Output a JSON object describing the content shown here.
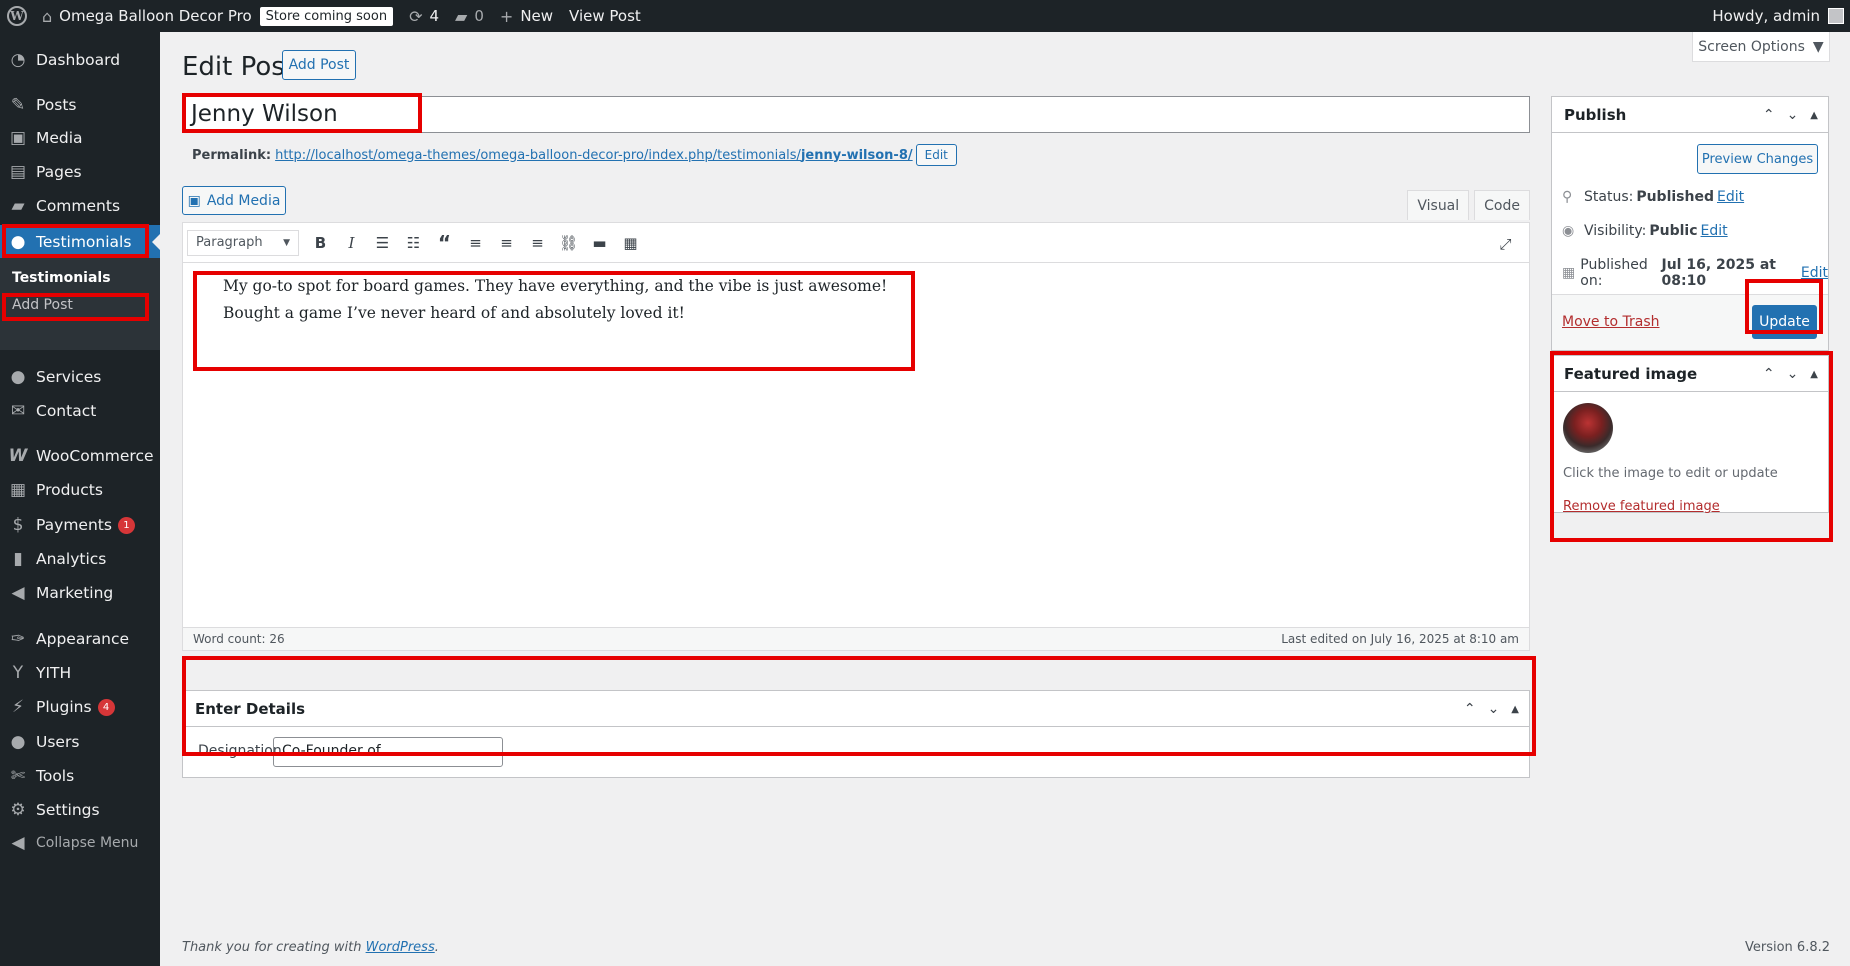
{
  "adminbar": {
    "site_name": "Omega Balloon Decor Pro",
    "store_badge": "Store coming soon",
    "updates_count": "4",
    "comments_count": "0",
    "new_label": "New",
    "view_post_label": "View Post",
    "howdy": "Howdy, admin"
  },
  "sidebar": {
    "items": [
      {
        "label": "Dashboard",
        "icon": "dashboard-icon"
      },
      {
        "label": "Posts",
        "icon": "pin-icon"
      },
      {
        "label": "Media",
        "icon": "media-icon"
      },
      {
        "label": "Pages",
        "icon": "pages-icon"
      },
      {
        "label": "Comments",
        "icon": "comments-icon"
      },
      {
        "label": "Testimonials",
        "icon": "user-icon"
      },
      {
        "label": "Services",
        "icon": "user-icon"
      },
      {
        "label": "Contact",
        "icon": "envelope-icon"
      },
      {
        "label": "WooCommerce",
        "icon": "woo-icon"
      },
      {
        "label": "Products",
        "icon": "archive-icon"
      },
      {
        "label": "Payments",
        "icon": "payments-icon",
        "badge": "1"
      },
      {
        "label": "Analytics",
        "icon": "chart-icon"
      },
      {
        "label": "Marketing",
        "icon": "megaphone-icon"
      },
      {
        "label": "Appearance",
        "icon": "brush-icon"
      },
      {
        "label": "YITH",
        "icon": "yith-icon"
      },
      {
        "label": "Plugins",
        "icon": "plugin-icon",
        "badge": "4"
      },
      {
        "label": "Users",
        "icon": "user-icon"
      },
      {
        "label": "Tools",
        "icon": "wrench-icon"
      },
      {
        "label": "Settings",
        "icon": "settings-icon"
      }
    ],
    "submenu_title": "Testimonials",
    "submenu_item": "Add Post",
    "collapse_label": "Collapse Menu"
  },
  "header": {
    "page_title": "Edit Post",
    "add_post_button": "Add Post",
    "screen_options": "Screen Options"
  },
  "post": {
    "title": "Jenny Wilson",
    "permalink_label": "Permalink:",
    "permalink_base": "http://localhost/omega-themes/omega-balloon-decor-pro/index.php/testimonials/",
    "permalink_slug": "jenny-wilson-8/",
    "permalink_edit": "Edit"
  },
  "editor": {
    "add_media": "Add Media",
    "tab_visual": "Visual",
    "tab_code": "Code",
    "format_select": "Paragraph",
    "content_line1": "My go-to spot for board games. They have everything, and the vibe is just awesome!",
    "content_line2": "Bought a game I’ve never heard of and absolutely loved it!",
    "word_count": "Word count: 26",
    "last_edited": "Last edited on July 16, 2025 at 8:10 am"
  },
  "details": {
    "title": "Enter Details",
    "designation_label": "Designation",
    "designation_value": "Co-Founder of"
  },
  "publish": {
    "title": "Publish",
    "preview_button": "Preview Changes",
    "status_label": "Status:",
    "status_value": "Published",
    "visibility_label": "Visibility:",
    "visibility_value": "Public",
    "published_label": "Published on:",
    "published_value": "Jul 16, 2025 at 08:10",
    "edit_link": "Edit",
    "trash_link": "Move to Trash",
    "update_button": "Update"
  },
  "featured": {
    "title": "Featured image",
    "hint": "Click the image to edit or update",
    "remove_link": "Remove featured image"
  },
  "footer": {
    "thanks_text": "Thank you for creating with",
    "wordpress_link": "WordPress",
    "version": "Version 6.8.2"
  },
  "colors": {
    "highlight": "#e60000",
    "accent": "#2271b1",
    "sidebar_bg": "#1d2327"
  }
}
